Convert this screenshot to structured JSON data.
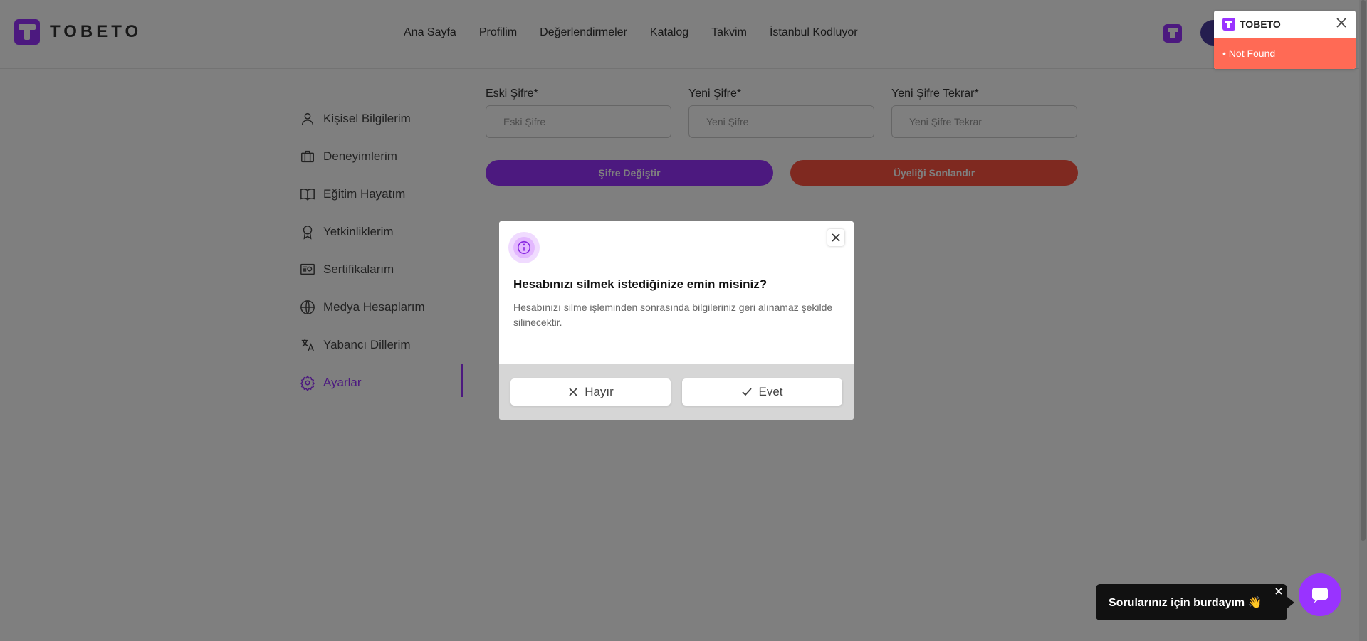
{
  "header": {
    "logo_text": "TOBETO",
    "nav": [
      "Ana Sayfa",
      "Profilim",
      "Değerlendirmeler",
      "Katalog",
      "Takvim",
      "İstanbul Kodluyor"
    ]
  },
  "sidebar": {
    "items": [
      {
        "label": "Kişisel Bilgilerim",
        "icon": "user-icon"
      },
      {
        "label": "Deneyimlerim",
        "icon": "briefcase-icon"
      },
      {
        "label": "Eğitim Hayatım",
        "icon": "book-icon"
      },
      {
        "label": "Yetkinliklerim",
        "icon": "award-icon"
      },
      {
        "label": "Sertifikalarım",
        "icon": "certificate-icon"
      },
      {
        "label": "Medya Hesaplarım",
        "icon": "globe-icon"
      },
      {
        "label": "Yabancı Dillerim",
        "icon": "translate-icon"
      },
      {
        "label": "Ayarlar",
        "icon": "gear-icon",
        "active": true
      }
    ]
  },
  "form": {
    "old_password": {
      "label": "Eski Şifre*",
      "placeholder": "Eski Şifre"
    },
    "new_password": {
      "label": "Yeni Şifre*",
      "placeholder": "Yeni Şifre"
    },
    "new_password_repeat": {
      "label": "Yeni Şifre Tekrar*",
      "placeholder": "Yeni Şifre Tekrar"
    },
    "change_button": "Şifre Değiştir",
    "delete_button": "Üyeliği Sonlandır"
  },
  "modal": {
    "title": "Hesabınızı silmek istediğinize emin misiniz?",
    "text": "Hesabınızı silme işleminden sonrasında bilgileriniz geri alınamaz şekilde silinecektir.",
    "no_label": "Hayır",
    "yes_label": "Evet"
  },
  "toast": {
    "title": "TOBETO",
    "message": "• Not Found"
  },
  "chat": {
    "bubble_text": "Sorularınız için burdayım 👋"
  },
  "colors": {
    "accent": "#9933ff",
    "danger": "#ff5241",
    "toast_error": "#ff6a55"
  }
}
